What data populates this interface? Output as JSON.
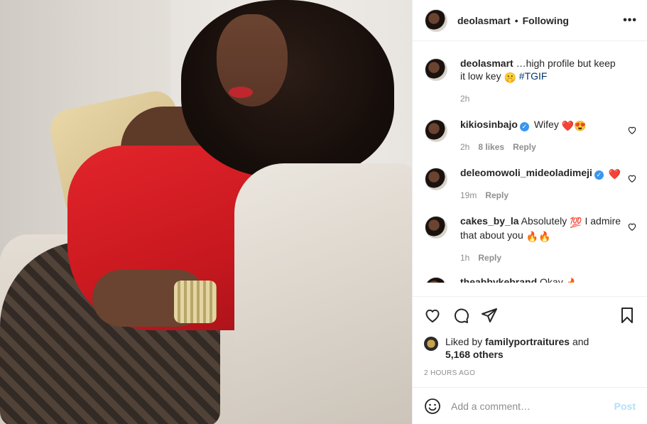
{
  "header": {
    "username": "deolasmart",
    "separator": "•",
    "follow_status": "Following",
    "more": "•••"
  },
  "caption": {
    "username": "deolasmart",
    "text": "…high profile but keep it low key",
    "emoji": "🤫",
    "hashtag": "#TGIF",
    "time": "2h"
  },
  "comments": [
    {
      "username": "kikiosinbajo",
      "verified": true,
      "text": "Wifey",
      "emojis": "❤️😍",
      "time": "2h",
      "likes": "8 likes",
      "reply": "Reply"
    },
    {
      "username": "deleomowoli_mideoladimeji",
      "verified": true,
      "text": "",
      "emojis": "❤️",
      "time": "19m",
      "reply": "Reply"
    },
    {
      "username": "cakes_by_la",
      "verified": false,
      "text": "Absolutely",
      "emoji_mid": "💯",
      "text2": "I admire that about you",
      "emojis": "🔥🔥",
      "time": "1h",
      "reply": "Reply"
    },
    {
      "username": "theabbykebrand",
      "text": "Okay",
      "emojis": "🔥"
    }
  ],
  "likes": {
    "prefix": "Liked by",
    "user": "familyportraitures",
    "and": "and",
    "others": "5,168 others"
  },
  "timestamp": "2 HOURS AGO",
  "add_comment": {
    "placeholder": "Add a comment…",
    "post_label": "Post"
  },
  "icons": {
    "like": "heart-icon",
    "comment": "comment-icon",
    "share": "share-icon",
    "save": "bookmark-icon",
    "emoji": "smiley-icon"
  },
  "colors": {
    "link": "#00376b",
    "verified": "#3897f0",
    "post_disabled": "#b2dffc",
    "muted": "#8e8e8e"
  }
}
